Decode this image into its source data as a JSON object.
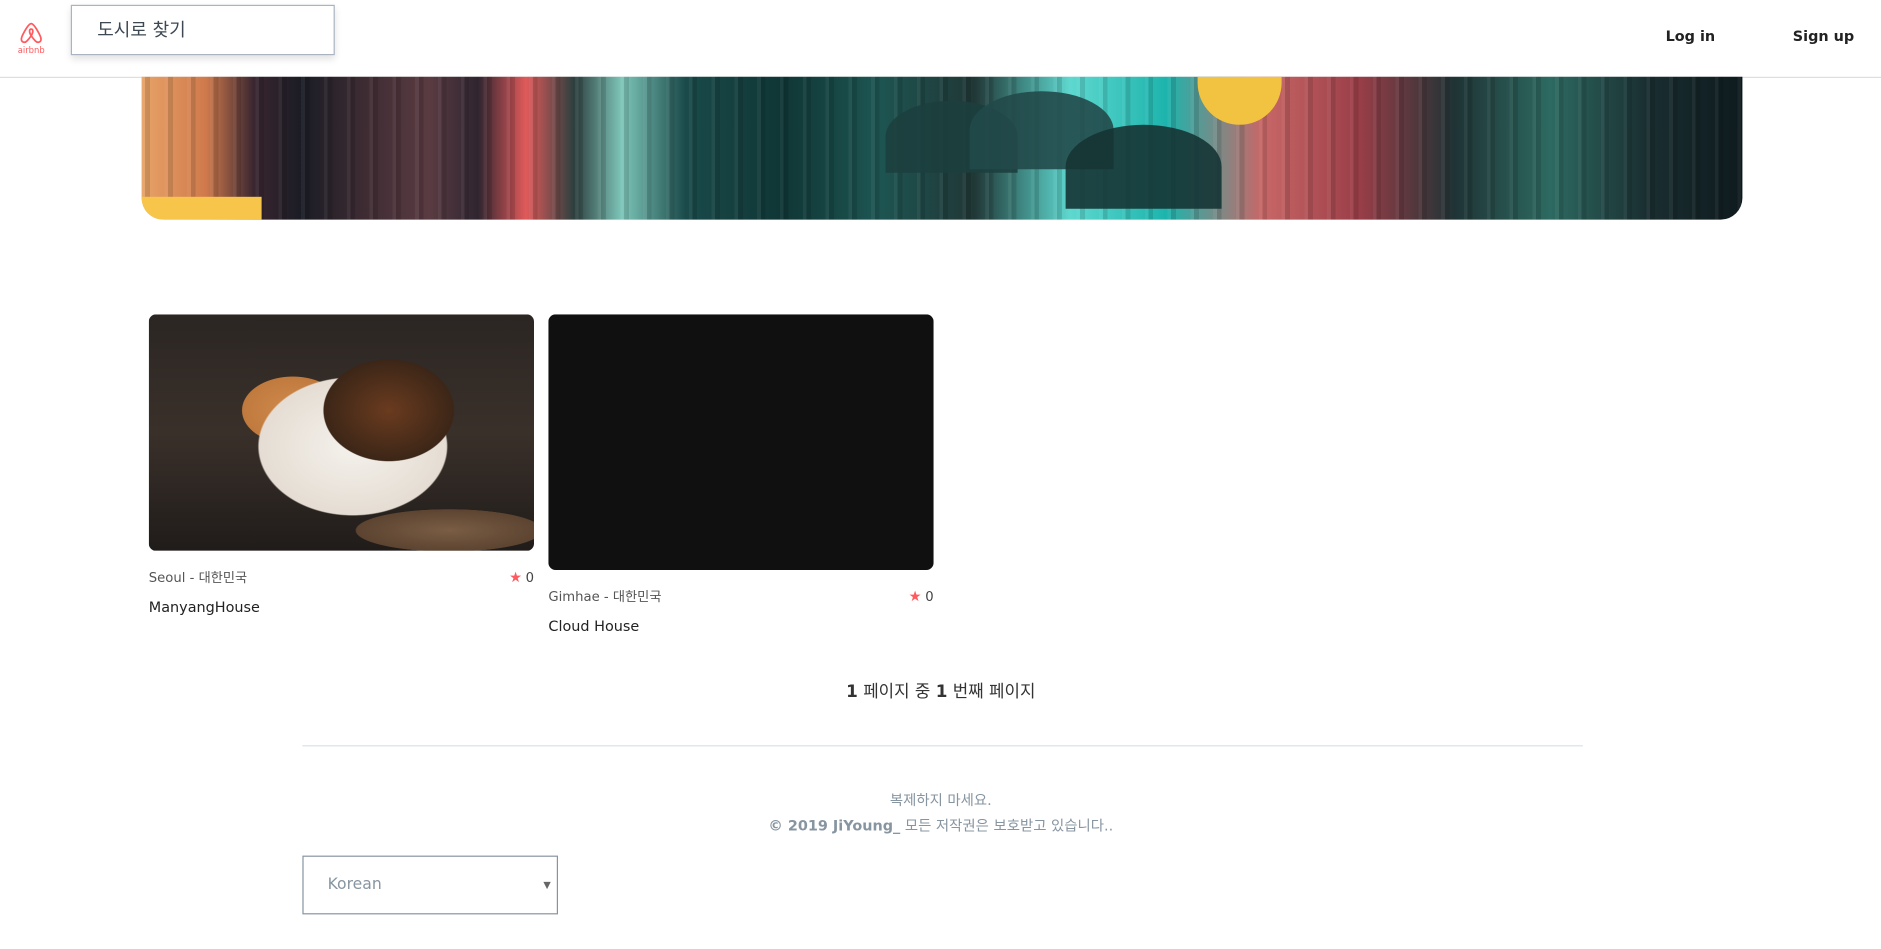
{
  "header": {
    "logo_text": "airbnb",
    "search_placeholder": "도시로 찾기",
    "login_label": "Log in",
    "signup_label": "Sign up"
  },
  "rooms": [
    {
      "location": "Seoul - 대한민국",
      "rating": "0",
      "name": "ManyangHouse",
      "photo": "calico-cat-sleeping"
    },
    {
      "location": "Gimhae - 대한민국",
      "rating": "0",
      "name": "Cloud House",
      "photo": "gray-kitten"
    }
  ],
  "pagination": {
    "total_pages": "1",
    "middle_text": "페이지 중",
    "current_page": "1",
    "suffix_text": "번째 페이지"
  },
  "footer": {
    "notice": "복제하지 마세요.",
    "copyright_bold": "© 2019 JiYoung_",
    "copyright_rest": "모든 저작권은 보호받고 있습니다..",
    "language_value": "Korean"
  },
  "colors": {
    "brand": "#ff5a5f",
    "footer_text": "#8795a1",
    "divider": "#dae1e7"
  }
}
